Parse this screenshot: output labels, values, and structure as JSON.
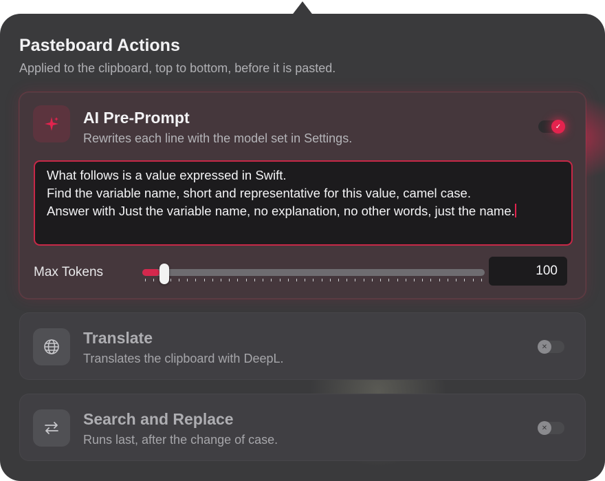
{
  "header": {
    "title": "Pasteboard Actions",
    "subtitle": "Applied to the clipboard, top to bottom, before it is pasted."
  },
  "actions": [
    {
      "title": "AI Pre-Prompt",
      "description": "Rewrites each line with the model set in Settings.",
      "icon": "sparkle-icon",
      "enabled": true,
      "prompt_lines": [
        "What follows is a value expressed in Swift.",
        "Find the variable name, short and representative for this value, camel case.",
        "Answer with Just the variable name, no explanation, no other words, just the name."
      ],
      "max_tokens_label": "Max Tokens",
      "max_tokens_value": "100",
      "slider_fraction": 0.03
    },
    {
      "title": "Translate",
      "description": "Translates the clipboard with DeepL.",
      "icon": "globe-icon",
      "enabled": false
    },
    {
      "title": "Search and Replace",
      "description": "Runs last, after the change of case.",
      "icon": "arrows-swap-icon",
      "enabled": false
    }
  ],
  "colors": {
    "accent": "#e3234e",
    "panel": "#3a3a3c",
    "card": "#403f43"
  }
}
